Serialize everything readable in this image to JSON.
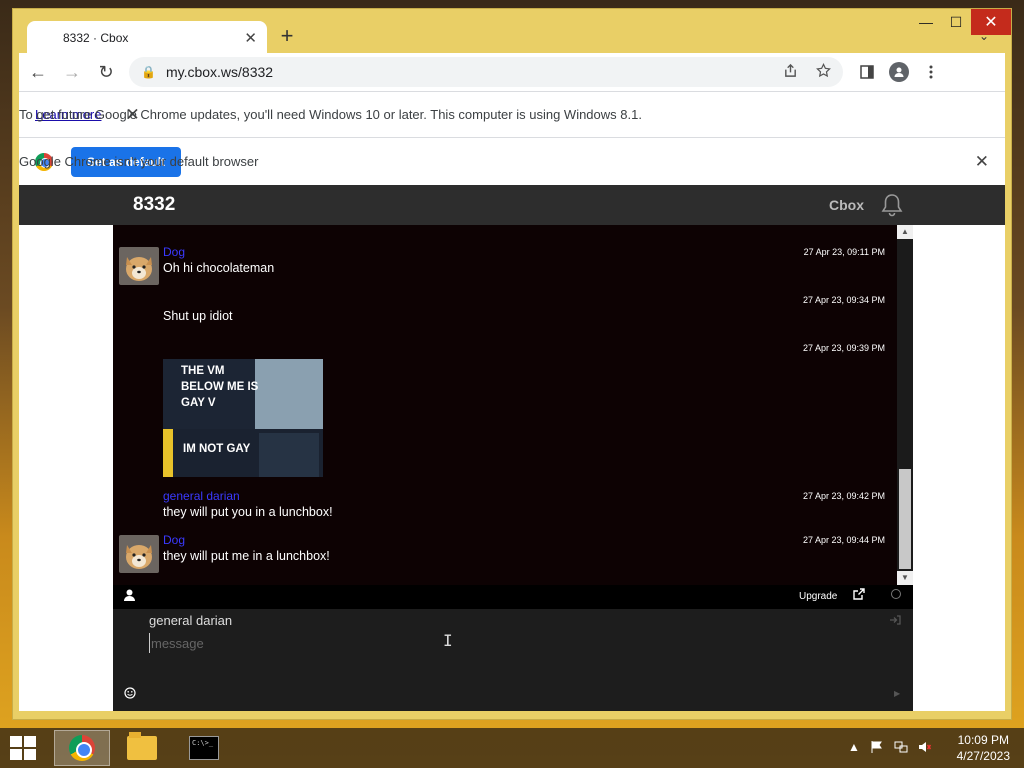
{
  "window": {
    "minimize_glyph": "—",
    "maximize_glyph": "☐",
    "close_glyph": "✕"
  },
  "tab": {
    "title": "8332 · Cbox",
    "close_glyph": "✕",
    "new_tab_glyph": "+",
    "menu_glyph": "⌄"
  },
  "toolbar": {
    "back_glyph": "←",
    "forward_glyph": "→",
    "reload_glyph": "↻",
    "url": "my.cbox.ws/8332",
    "lock_glyph": "🔒"
  },
  "infobar_update": {
    "message": "To get future Google Chrome updates, you'll need Windows 10 or later. This computer is using Windows 8.1.",
    "link": "Learn more",
    "close_glyph": "✕"
  },
  "infobar_default": {
    "message": "Google Chrome isn't your default browser",
    "button": "Set as default",
    "close_glyph": "✕"
  },
  "cbox": {
    "title": "8332",
    "brand": "Cbox",
    "upgrade": "Upgrade",
    "current_user": "general darian",
    "message_placeholder": "message"
  },
  "messages": [
    {
      "name": "Dog",
      "text": "Oh hi chocolateman",
      "time": "27 Apr 23, 09:11 PM",
      "avatar": true
    },
    {
      "name": "",
      "text": "Shut up idiot",
      "time": "27 Apr 23, 09:34 PM",
      "avatar": false
    },
    {
      "name": "",
      "text": "",
      "time": "27 Apr 23, 09:39 PM",
      "avatar": false,
      "image": true,
      "image_caption_top": "THE VM BELOW ME IS GAY V",
      "image_caption_bottom": "IM NOT GAY"
    },
    {
      "name": "general darian",
      "text": "they will put you in a lunchbox!",
      "time": "27 Apr 23, 09:42 PM",
      "avatar": false
    },
    {
      "name": "Dog",
      "text": "they will put me in a lunchbox!",
      "time": "27 Apr 23, 09:44 PM",
      "avatar": true
    }
  ],
  "taskbar": {
    "time": "10:09 PM",
    "date": "4/27/2023",
    "tray_up_glyph": "▲"
  }
}
